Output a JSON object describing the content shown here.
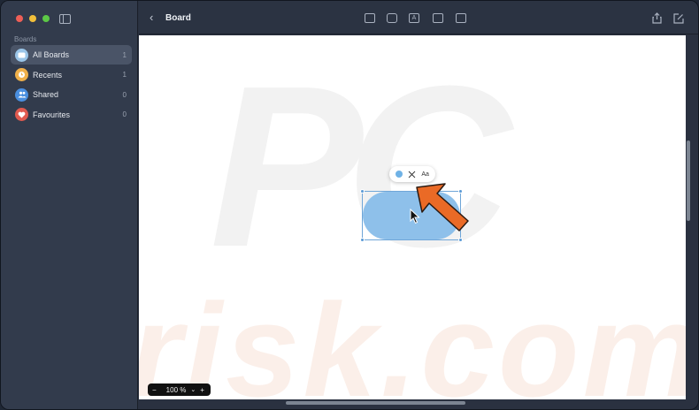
{
  "sidebar": {
    "section": "Boards",
    "items": [
      {
        "label": "All Boards",
        "count": "1",
        "icon": "boards-icon",
        "color": "#9ac5e8"
      },
      {
        "label": "Recents",
        "count": "1",
        "icon": "clock-icon",
        "color": "#f0b04a"
      },
      {
        "label": "Shared",
        "count": "0",
        "icon": "people-icon",
        "color": "#4a8fe0"
      },
      {
        "label": "Favourites",
        "count": "0",
        "icon": "heart-icon",
        "color": "#e05a4f"
      }
    ]
  },
  "toolbar": {
    "back_icon": "chevron-left-icon",
    "title": "Board",
    "tools": [
      "sticky-note-icon",
      "shapes-icon",
      "text-box-icon",
      "media-icon",
      "folder-icon"
    ],
    "right": [
      "share-icon",
      "new-board-icon"
    ]
  },
  "canvas": {
    "watermark_top": "PC",
    "watermark_bottom": "risk.com",
    "mini_toolbar": {
      "fill_icon": "fill-color-icon",
      "line_icon": "line-style-icon",
      "text": "Aa"
    },
    "shape_fill": "#8ec0ea"
  },
  "zoom": {
    "minus": "−",
    "value": "100 %",
    "chevron": "⌄",
    "plus": "+"
  }
}
